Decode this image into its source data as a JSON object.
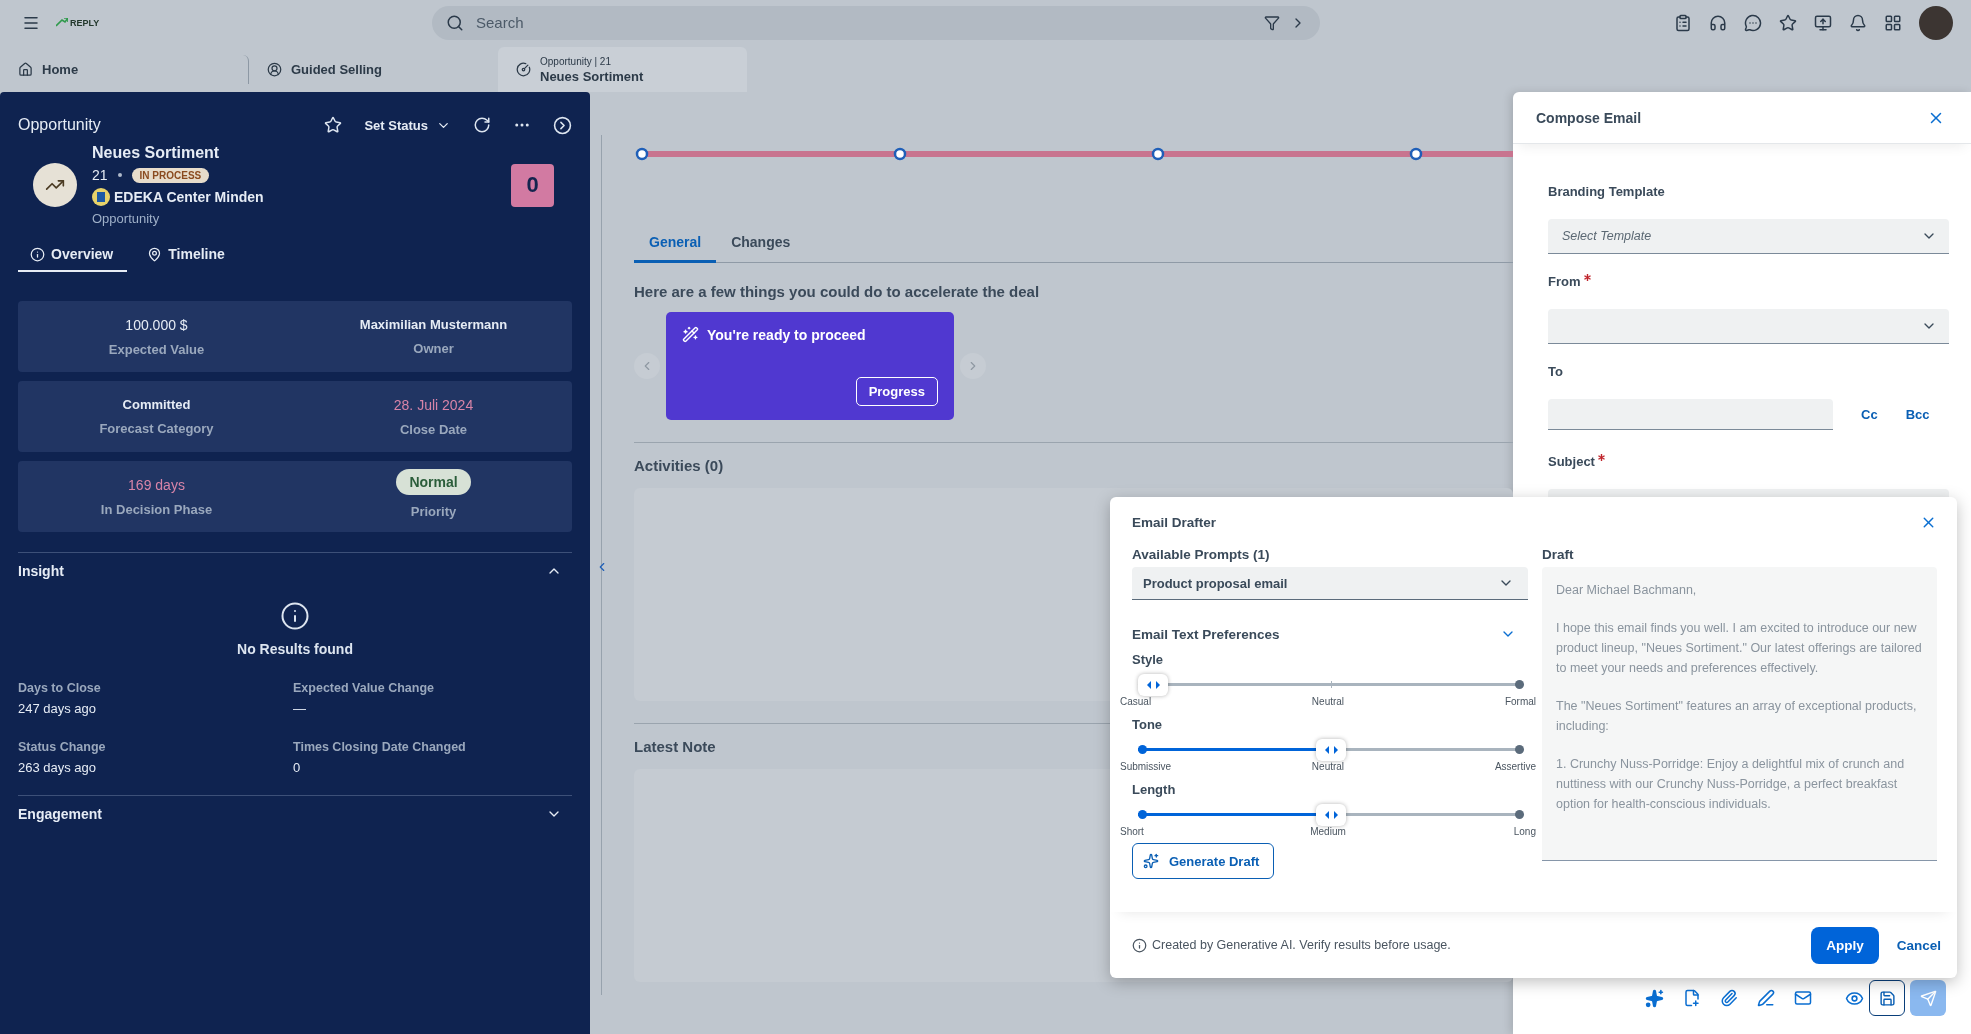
{
  "shell": {
    "logo": "REPLY",
    "search": {
      "placeholder": "Search"
    }
  },
  "tabs": [
    {
      "label": "Home",
      "selected": false
    },
    {
      "label": "Guided Selling",
      "selected": false
    },
    {
      "overline": "Opportunity | 21",
      "label": "Neues Sortiment",
      "selected": true
    }
  ],
  "object_panel": {
    "title": "Opportunity",
    "set_status": "Set Status",
    "name": "Neues Sortiment",
    "id": "21",
    "status": "IN PROCESS",
    "account": "EDEKA Center Minden",
    "type": "Opportunity",
    "score": "0",
    "tabs": [
      {
        "label": "Overview",
        "selected": true
      },
      {
        "label": "Timeline",
        "selected": false
      }
    ],
    "kpi_cards": [
      {
        "items": [
          {
            "value": "100.000 $",
            "label": "Expected Value",
            "kind": "plain"
          },
          {
            "value": "Maximilian Mustermann",
            "label": "Owner",
            "kind": "strong"
          }
        ]
      },
      {
        "items": [
          {
            "value": "Committed",
            "label": "Forecast Category",
            "kind": "strong"
          },
          {
            "value": "28. Juli 2024",
            "label": "Close Date",
            "kind": "alert"
          }
        ]
      },
      {
        "items": [
          {
            "value": "169 days",
            "label": "In Decision Phase",
            "kind": "alert"
          },
          {
            "value": "Normal",
            "label": "Priority",
            "kind": "badge"
          }
        ]
      }
    ],
    "insight": {
      "title": "Insight",
      "expanded": true,
      "empty_text": "No Results found",
      "stats": [
        {
          "label": "Days to Close",
          "value": "247 days ago"
        },
        {
          "label": "Expected Value Change",
          "value": "—"
        },
        {
          "label": "Status Change",
          "value": "263 days ago"
        },
        {
          "label": "Times Closing Date Changed",
          "value": "0"
        }
      ]
    },
    "engagement": {
      "title": "Engagement",
      "expanded": false
    }
  },
  "main": {
    "tabs": [
      {
        "label": "General",
        "selected": true
      },
      {
        "label": "Changes",
        "selected": false
      }
    ],
    "heading": "Here are a few things you could do to accelerate the deal",
    "suggestion": {
      "title": "You're ready to proceed",
      "action": "Progress"
    },
    "sections": [
      {
        "title": "Activities (0)"
      },
      {
        "title": "Latest Note"
      }
    ]
  },
  "compose": {
    "title": "Compose Email",
    "fields": [
      {
        "label": "Branding Template",
        "required": false,
        "kind": "select",
        "placeholder": "Select Template"
      },
      {
        "label": "From",
        "required": true,
        "kind": "select"
      },
      {
        "label": "To",
        "required": false,
        "kind": "recipients",
        "links": [
          "Cc",
          "Bcc"
        ]
      },
      {
        "label": "Subject",
        "required": true,
        "kind": "text"
      }
    ]
  },
  "drafter": {
    "title": "Email Drafter",
    "prompts_label": "Available Prompts (1)",
    "prompt": "Product proposal email",
    "preferences": {
      "title": "Email Text Preferences",
      "expanded": true,
      "sliders": [
        {
          "label": "Style",
          "level": 0,
          "ticks": [
            "Casual",
            "Neutral",
            "Formal"
          ]
        },
        {
          "label": "Tone",
          "level": 0.5,
          "ticks": [
            "Submissive",
            "Neutral",
            "Assertive"
          ]
        },
        {
          "label": "Length",
          "level": 0.5,
          "ticks": [
            "Short",
            "Medium",
            "Long"
          ]
        }
      ]
    },
    "generate": "Generate Draft",
    "draft_label": "Draft",
    "draft": [
      "Dear Michael Bachmann,",
      "I hope this email finds you well. I am excited to introduce our new product lineup, \"Neues Sortiment.\" Our latest offerings are tailored to meet your needs and preferences effectively.",
      "The \"Neues Sortiment\" features an array of exceptional products, including:",
      "1. Crunchy Nuss-Porridge: Enjoy a delightful mix of crunch and nuttiness with our Crunchy Nuss-Porridge, a perfect breakfast option for health-conscious individuals."
    ],
    "note": "Created by Generative AI. Verify results before usage.",
    "apply": "Apply",
    "cancel": "Cancel"
  }
}
